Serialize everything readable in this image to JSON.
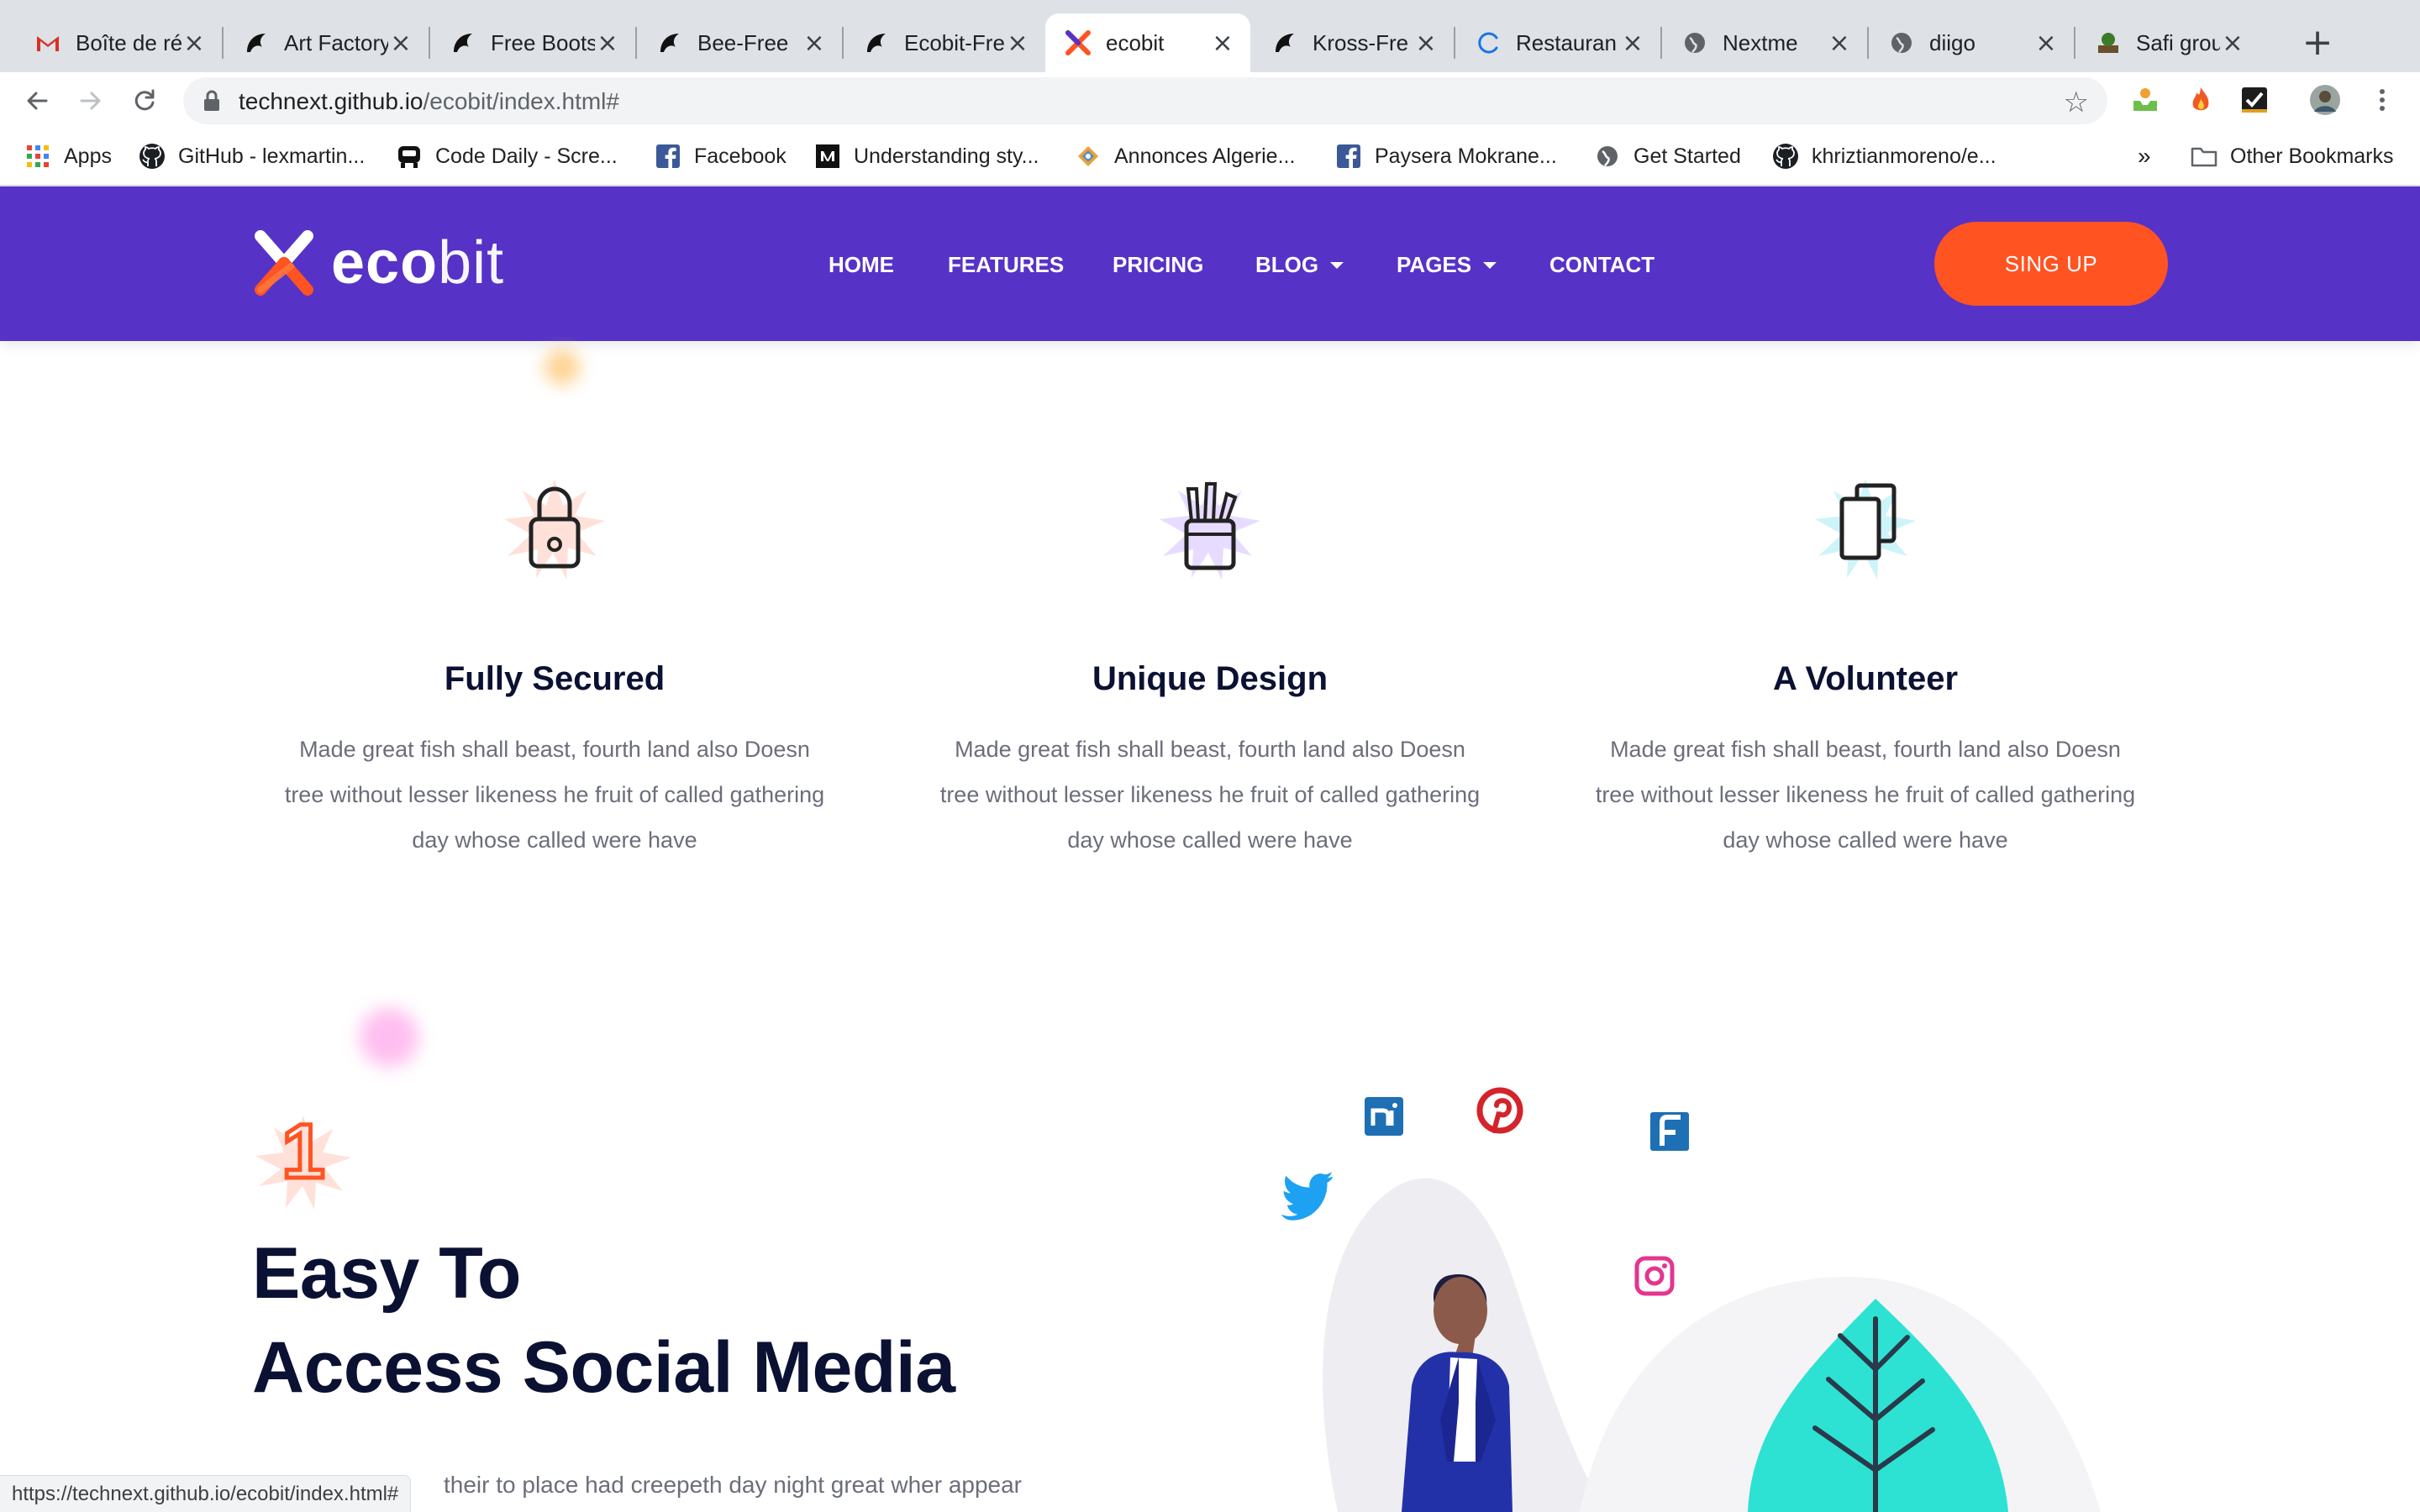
{
  "browser": {
    "tabs": [
      {
        "title": "Boîte de ré",
        "icon": "gmail-icon",
        "active": false
      },
      {
        "title": "Art Factory",
        "icon": "colorlib-icon",
        "active": false
      },
      {
        "title": "Free Boots",
        "icon": "colorlib-icon",
        "active": false
      },
      {
        "title": "Bee-Free",
        "icon": "colorlib-icon",
        "active": false
      },
      {
        "title": "Ecobit-Fre",
        "icon": "colorlib-icon",
        "active": false
      },
      {
        "title": "ecobit",
        "icon": "ecobit-icon",
        "active": true
      },
      {
        "title": "Kross-Fre",
        "icon": "colorlib-icon",
        "active": false
      },
      {
        "title": "Restauran",
        "icon": "loading-icon",
        "active": false
      },
      {
        "title": "Nextme",
        "icon": "globe-icon",
        "active": false
      },
      {
        "title": "diigo",
        "icon": "globe-icon",
        "active": false
      },
      {
        "title": "Safi group",
        "icon": "safi-icon",
        "active": false
      }
    ],
    "url_host": "technext.github.io",
    "url_path": "/ecobit/index.html#",
    "bookmarks": [
      {
        "label": "Apps",
        "icon": "apps-grid-icon"
      },
      {
        "label": "GitHub - lexmartin...",
        "icon": "github-icon"
      },
      {
        "label": "Code Daily - Scre...",
        "icon": "codedaily-icon"
      },
      {
        "label": "Facebook",
        "icon": "facebook-icon"
      },
      {
        "label": "Understanding sty...",
        "icon": "medium-icon"
      },
      {
        "label": "Annonces Algerie...",
        "icon": "annonces-icon"
      },
      {
        "label": "Paysera  Mokrane...",
        "icon": "facebook-icon"
      },
      {
        "label": "Get Started",
        "icon": "globe-icon"
      },
      {
        "label": "khriztianmoreno/e...",
        "icon": "github-icon"
      }
    ],
    "bookmarks_overflow": "»",
    "other_bookmarks": "Other Bookmarks",
    "status_url": "https://technext.github.io/ecobit/index.html#"
  },
  "site": {
    "logo_bold": "eco",
    "logo_light": "bit",
    "nav": [
      {
        "label": "HOME",
        "dropdown": false
      },
      {
        "label": "FEATURES",
        "dropdown": false
      },
      {
        "label": "PRICING",
        "dropdown": false
      },
      {
        "label": "BLOG",
        "dropdown": true
      },
      {
        "label": "PAGES",
        "dropdown": true
      },
      {
        "label": "CONTACT",
        "dropdown": false
      }
    ],
    "signup_label": "SING UP",
    "colors": {
      "header_bg": "#5632c7",
      "accent": "#ff5322",
      "heading": "#0b1133",
      "body_text": "#6b6e7a"
    }
  },
  "features": [
    {
      "title": "Fully Secured",
      "icon": "padlock-icon",
      "text": "Made great fish shall beast, fourth land also Doesn tree without lesser likeness he fruit of called gathering day whose called were have"
    },
    {
      "title": "Unique Design",
      "icon": "pencil-cup-icon",
      "text": "Made great fish shall beast, fourth land also Doesn tree without lesser likeness he fruit of called gathering day whose called were have"
    },
    {
      "title": "A Volunteer",
      "icon": "documents-icon",
      "text": "Made great fish shall beast, fourth land also Doesn tree without lesser likeness he fruit of called gathering day whose called were have"
    }
  ],
  "social_section": {
    "number": "1",
    "title_line1": "Easy To",
    "title_line2": "Access Social Media",
    "body": "their to place had creepeth day night great wher appear",
    "icons": [
      "nextdoor-icon",
      "pinterest-icon",
      "foursquare-icon",
      "twitter-icon",
      "instagram-icon"
    ]
  }
}
